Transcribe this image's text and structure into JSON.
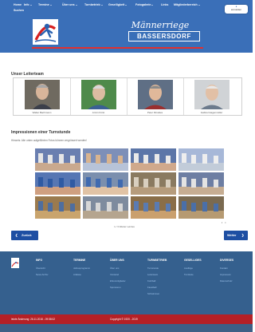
{
  "nav": {
    "items": [
      {
        "label": "Home",
        "dropdown": false
      },
      {
        "label": "Info",
        "dropdown": true
      },
      {
        "label": "Termine",
        "dropdown": true
      },
      {
        "label": "Über uns",
        "dropdown": true
      },
      {
        "label": "Turnbetrieb",
        "dropdown": true
      },
      {
        "label": "Geselligkeit",
        "dropdown": true
      },
      {
        "label": "Fotogalerie",
        "dropdown": true
      },
      {
        "label": "Links",
        "dropdown": false
      },
      {
        "label": "Mitgliederbereich",
        "dropdown": true
      }
    ],
    "search_label": "Suchen",
    "login_label": "anmelden"
  },
  "header": {
    "title": "Männerriege",
    "subtitle": "BASSERSDORF"
  },
  "leiter": {
    "heading": "Unser Leiterteam",
    "people": [
      {
        "name": "Walter Bachmann"
      },
      {
        "name": "Armin Fürst"
      },
      {
        "name": "Peter Dinskies"
      },
      {
        "name": "Gabriel Hagenmüller"
      }
    ]
  },
  "gallery": {
    "heading": "Impressionen einer Turnstunde",
    "hint": "Hinweis: Alle unten aufgeführten Fotos können vergrössert werden!",
    "dots": "• •",
    "counter": "1 / 3 Weiter   Letztes",
    "thumbs": [
      {
        "name": "gallery-thumb-1"
      },
      {
        "name": "gallery-thumb-2"
      },
      {
        "name": "gallery-thumb-3"
      },
      {
        "name": "gallery-thumb-4"
      },
      {
        "name": "gallery-thumb-5"
      },
      {
        "name": "gallery-thumb-6"
      },
      {
        "name": "gallery-thumb-7"
      },
      {
        "name": "gallery-thumb-8"
      },
      {
        "name": "gallery-thumb-9"
      },
      {
        "name": "gallery-thumb-10"
      },
      {
        "name": "gallery-thumb-11"
      },
      {
        "name": "gallery-thumb-12"
      }
    ]
  },
  "pager": {
    "back_label": "Zurück",
    "next_label": "Weiter"
  },
  "footer": {
    "columns": [
      {
        "heading": "INFO",
        "links": [
          "Übersicht",
          "News Archiv"
        ]
      },
      {
        "heading": "TERMINE",
        "links": [
          "Jahresprogramm",
          "Anlässe"
        ]
      },
      {
        "heading": "ÜBER UNS",
        "links": [
          "Über uns",
          "Vorstand",
          "Ehrenmitglieder",
          "Sponsoren"
        ]
      },
      {
        "heading": "TURNBETRIEB",
        "links": [
          "Turnstunde",
          "Leiterteam",
          "Korbball",
          "Faustball",
          "Schwimmen"
        ]
      },
      {
        "heading": "GESELLIGES",
        "links": [
          "Ausflüge",
          "Turnfeste"
        ]
      },
      {
        "heading": "DIVERSES",
        "links": [
          "Kontakt",
          "Impressum",
          "Datenschutz"
        ]
      }
    ],
    "last_update": "letzte Änderung: 26.11.2018 - 09:58:02",
    "copyright": "Copyright © 1920 - 2019"
  },
  "colors": {
    "nav_blue": "#3a6fb8",
    "accent_red": "#b52026",
    "button_blue": "#1e4fa3",
    "footer_blue": "#35608e"
  }
}
